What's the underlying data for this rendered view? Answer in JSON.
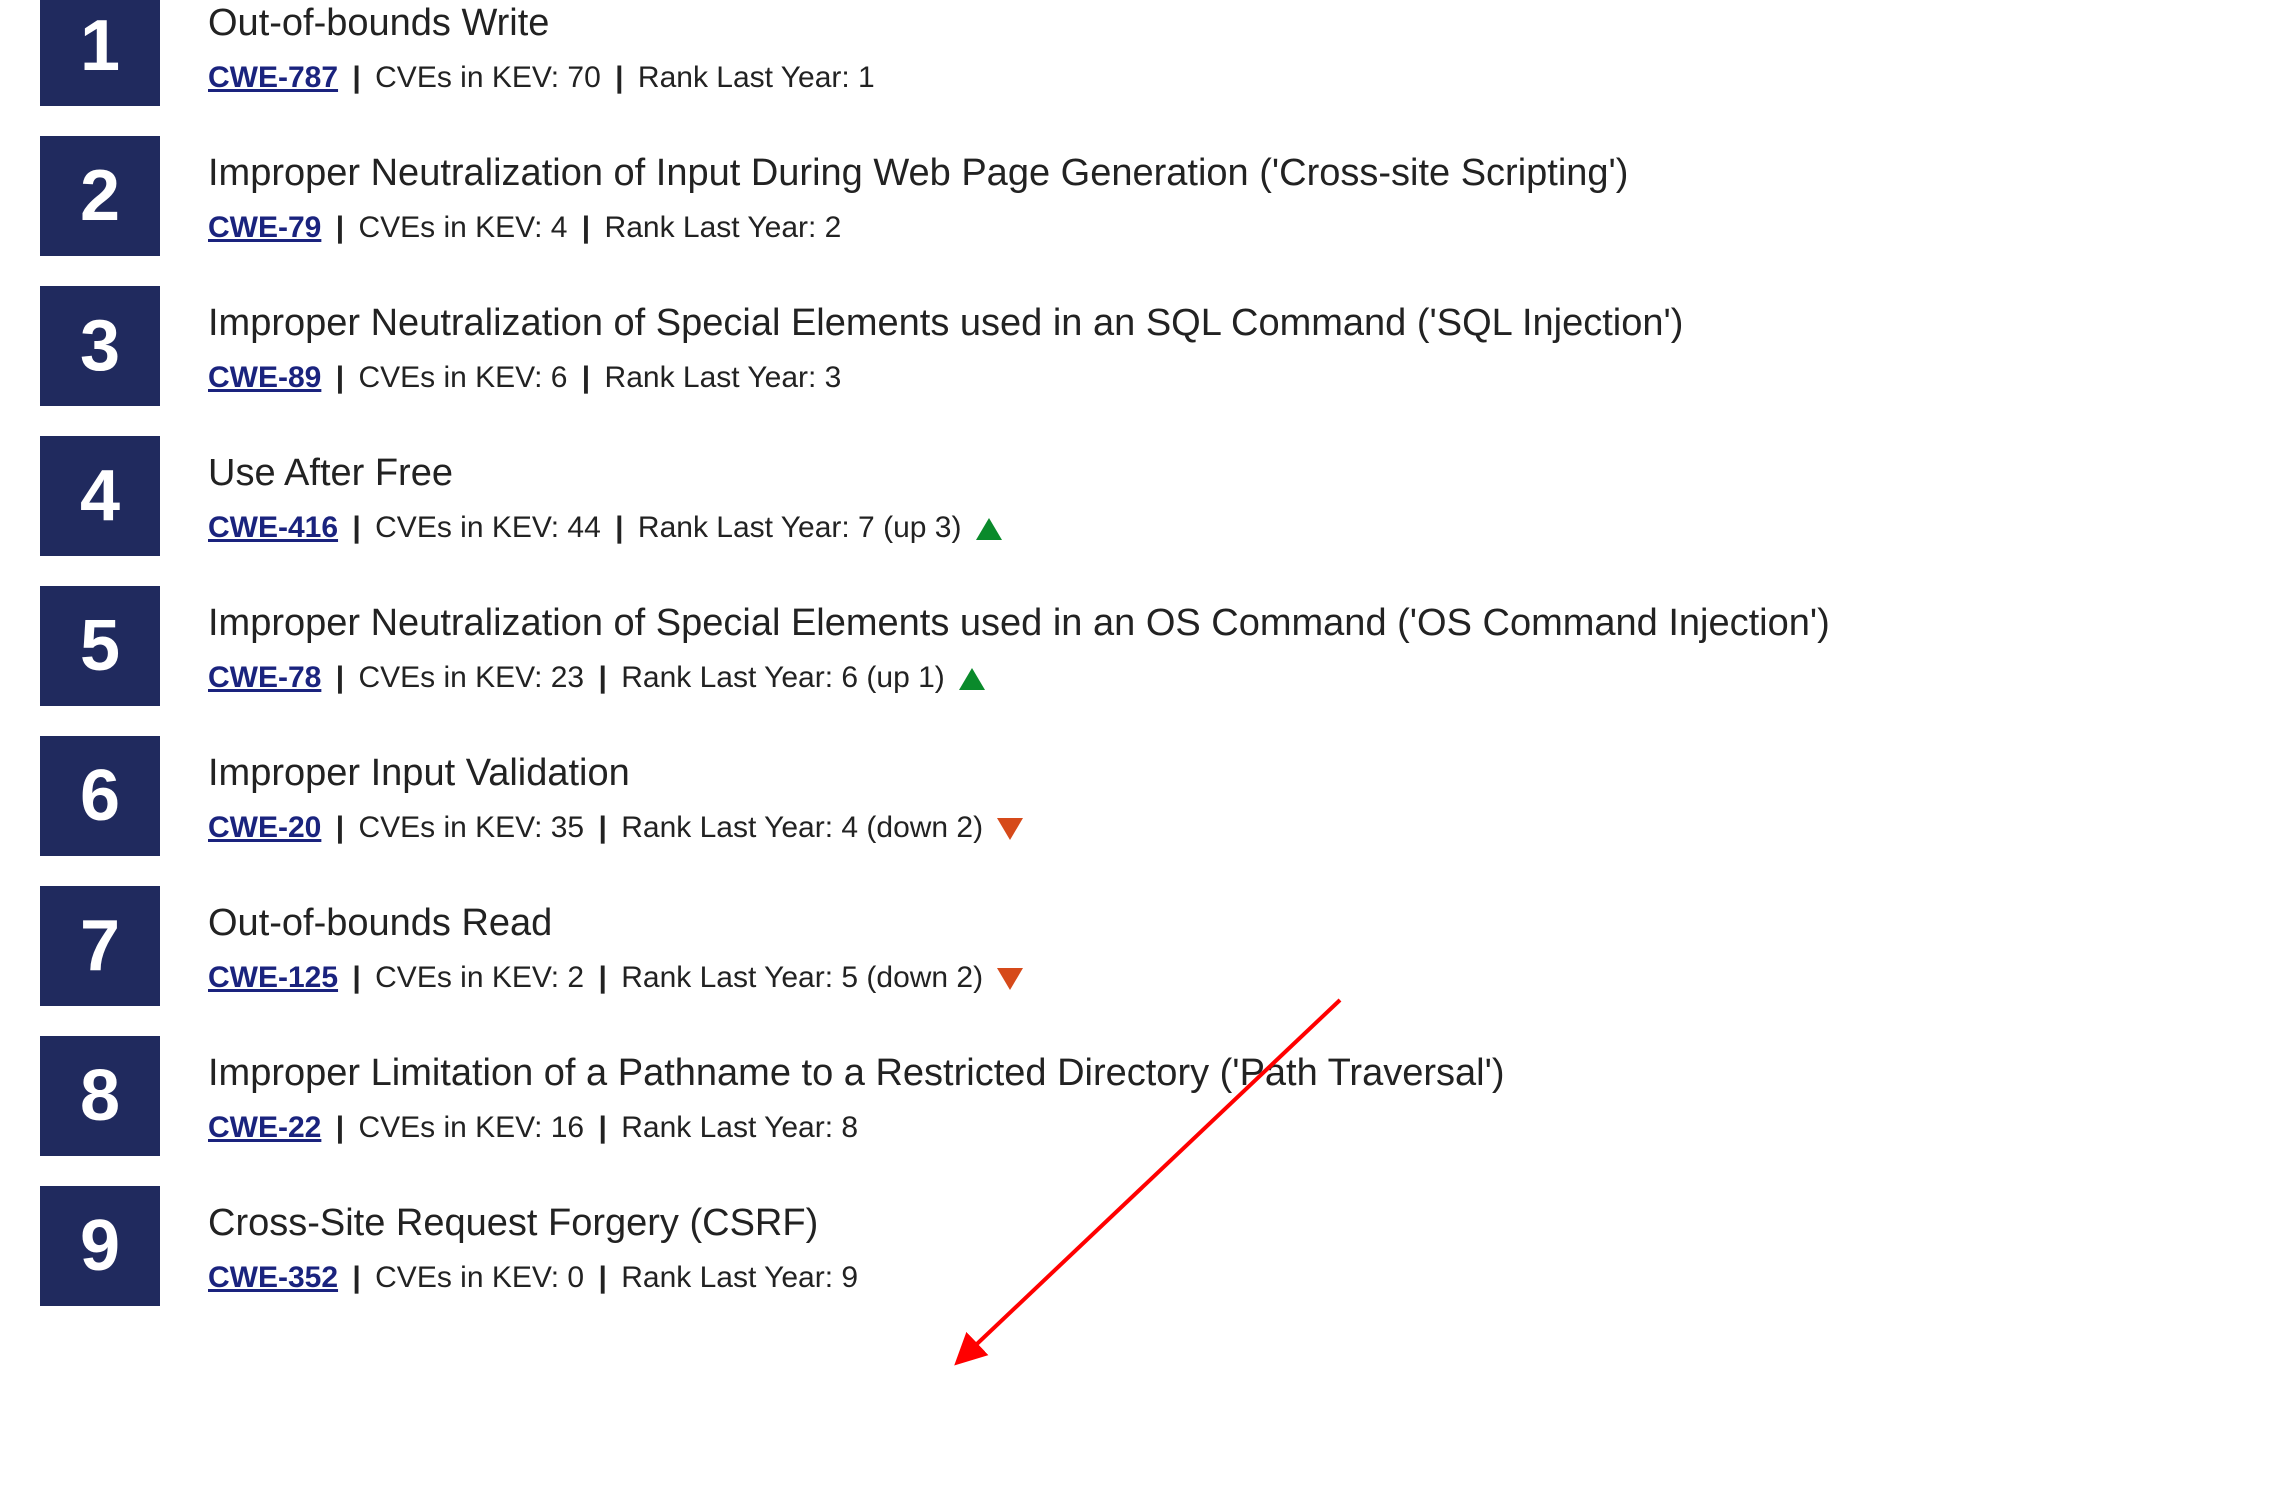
{
  "items": [
    {
      "rank": "1",
      "title": "Out-of-bounds Write",
      "cwe": "CWE-787",
      "kev": "CVEs in KEV: 70",
      "rly": "Rank Last Year: 1",
      "dir": "none"
    },
    {
      "rank": "2",
      "title": "Improper Neutralization of Input During Web Page Generation ('Cross-site Scripting')",
      "cwe": "CWE-79",
      "kev": "CVEs in KEV: 4",
      "rly": "Rank Last Year: 2",
      "dir": "none"
    },
    {
      "rank": "3",
      "title": "Improper Neutralization of Special Elements used in an SQL Command ('SQL Injection')",
      "cwe": "CWE-89",
      "kev": "CVEs in KEV: 6",
      "rly": "Rank Last Year: 3",
      "dir": "none"
    },
    {
      "rank": "4",
      "title": "Use After Free",
      "cwe": "CWE-416",
      "kev": "CVEs in KEV: 44",
      "rly": "Rank Last Year: 7 (up 3)",
      "dir": "up"
    },
    {
      "rank": "5",
      "title": "Improper Neutralization of Special Elements used in an OS Command ('OS Command Injection')",
      "cwe": "CWE-78",
      "kev": "CVEs in KEV: 23",
      "rly": "Rank Last Year: 6 (up 1)",
      "dir": "up"
    },
    {
      "rank": "6",
      "title": "Improper Input Validation",
      "cwe": "CWE-20",
      "kev": "CVEs in KEV: 35",
      "rly": "Rank Last Year: 4 (down 2)",
      "dir": "down"
    },
    {
      "rank": "7",
      "title": "Out-of-bounds Read",
      "cwe": "CWE-125",
      "kev": "CVEs in KEV: 2",
      "rly": "Rank Last Year: 5 (down 2)",
      "dir": "down"
    },
    {
      "rank": "8",
      "title": "Improper Limitation of a Pathname to a Restricted Directory ('Path Traversal')",
      "cwe": "CWE-22",
      "kev": "CVEs in KEV: 16",
      "rly": "Rank Last Year: 8",
      "dir": "none"
    },
    {
      "rank": "9",
      "title": "Cross-Site Request Forgery (CSRF)",
      "cwe": "CWE-352",
      "kev": "CVEs in KEV: 0",
      "rly": "Rank Last Year: 9",
      "dir": "none"
    }
  ],
  "annotation": {
    "arrow_color": "#ff0000"
  }
}
